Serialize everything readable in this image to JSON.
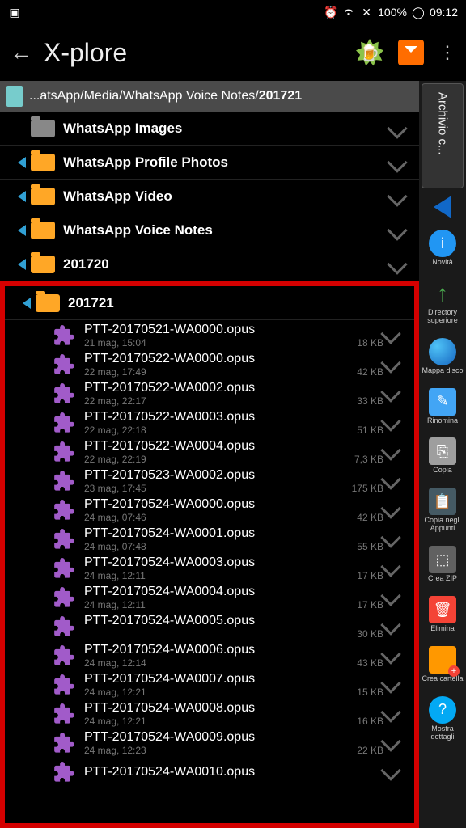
{
  "status": {
    "time": "09:12",
    "battery": "100%"
  },
  "app": {
    "title": "X-plore"
  },
  "breadcrumb": {
    "prefix": "...atsApp/Media/WhatsApp Voice Notes/",
    "current": "201721"
  },
  "folders": [
    {
      "name": "WhatsApp Images",
      "color": "gray",
      "tri": false
    },
    {
      "name": "WhatsApp Profile Photos",
      "color": "yellow",
      "tri": true
    },
    {
      "name": "WhatsApp Video",
      "color": "yellow",
      "tri": true
    },
    {
      "name": "WhatsApp Voice Notes",
      "color": "yellow",
      "tri": true
    },
    {
      "name": "201720",
      "color": "yellow",
      "tri": true
    }
  ],
  "current_folder": {
    "name": "201721"
  },
  "files": [
    {
      "name": "PTT-20170521-WA0000.opus",
      "date": "21 mag, 15:04",
      "size": "18 KB"
    },
    {
      "name": "PTT-20170522-WA0000.opus",
      "date": "22 mag, 17:49",
      "size": "42 KB"
    },
    {
      "name": "PTT-20170522-WA0002.opus",
      "date": "22 mag, 22:17",
      "size": "33 KB"
    },
    {
      "name": "PTT-20170522-WA0003.opus",
      "date": "22 mag, 22:18",
      "size": "51 KB"
    },
    {
      "name": "PTT-20170522-WA0004.opus",
      "date": "22 mag, 22:19",
      "size": "7,3 KB"
    },
    {
      "name": "PTT-20170523-WA0002.opus",
      "date": "23 mag, 17:45",
      "size": "175 KB"
    },
    {
      "name": "PTT-20170524-WA0000.opus",
      "date": "24 mag, 07:46",
      "size": "42 KB"
    },
    {
      "name": "PTT-20170524-WA0001.opus",
      "date": "24 mag, 07:48",
      "size": "55 KB"
    },
    {
      "name": "PTT-20170524-WA0003.opus",
      "date": "24 mag, 12:11",
      "size": "17 KB"
    },
    {
      "name": "PTT-20170524-WA0004.opus",
      "date": "24 mag, 12:11",
      "size": "17 KB"
    },
    {
      "name": "PTT-20170524-WA0005.opus",
      "date": "",
      "size": "30 KB"
    },
    {
      "name": "PTT-20170524-WA0006.opus",
      "date": "24 mag, 12:14",
      "size": "43 KB"
    },
    {
      "name": "PTT-20170524-WA0007.opus",
      "date": "24 mag, 12:21",
      "size": "15 KB"
    },
    {
      "name": "PTT-20170524-WA0008.opus",
      "date": "24 mag, 12:21",
      "size": "16 KB"
    },
    {
      "name": "PTT-20170524-WA0009.opus",
      "date": "24 mag, 12:23",
      "size": "22 KB"
    },
    {
      "name": "PTT-20170524-WA0010.opus",
      "date": "",
      "size": ""
    }
  ],
  "sidebar": {
    "tab": "Archivio c...",
    "tools": [
      {
        "label": "Novità",
        "cls": "ti-blue",
        "glyph": "i"
      },
      {
        "label": "Directory superiore",
        "cls": "ti-green",
        "glyph": "↑"
      },
      {
        "label": "Mappa disco",
        "cls": "ti-globe",
        "glyph": ""
      },
      {
        "label": "Rinomina",
        "cls": "ti-file",
        "glyph": "✎"
      },
      {
        "label": "Copia",
        "cls": "ti-copy",
        "glyph": "⎘"
      },
      {
        "label": "Copia negli Appunti",
        "cls": "ti-clip",
        "glyph": "📋"
      },
      {
        "label": "Crea ZIP",
        "cls": "ti-zip",
        "glyph": "⬚"
      },
      {
        "label": "Elimina",
        "cls": "ti-trash",
        "glyph": "🗑"
      },
      {
        "label": "Crea cartella",
        "cls": "ti-folder",
        "glyph": ""
      },
      {
        "label": "Mostra dettagli",
        "cls": "ti-help",
        "glyph": "?"
      }
    ]
  }
}
